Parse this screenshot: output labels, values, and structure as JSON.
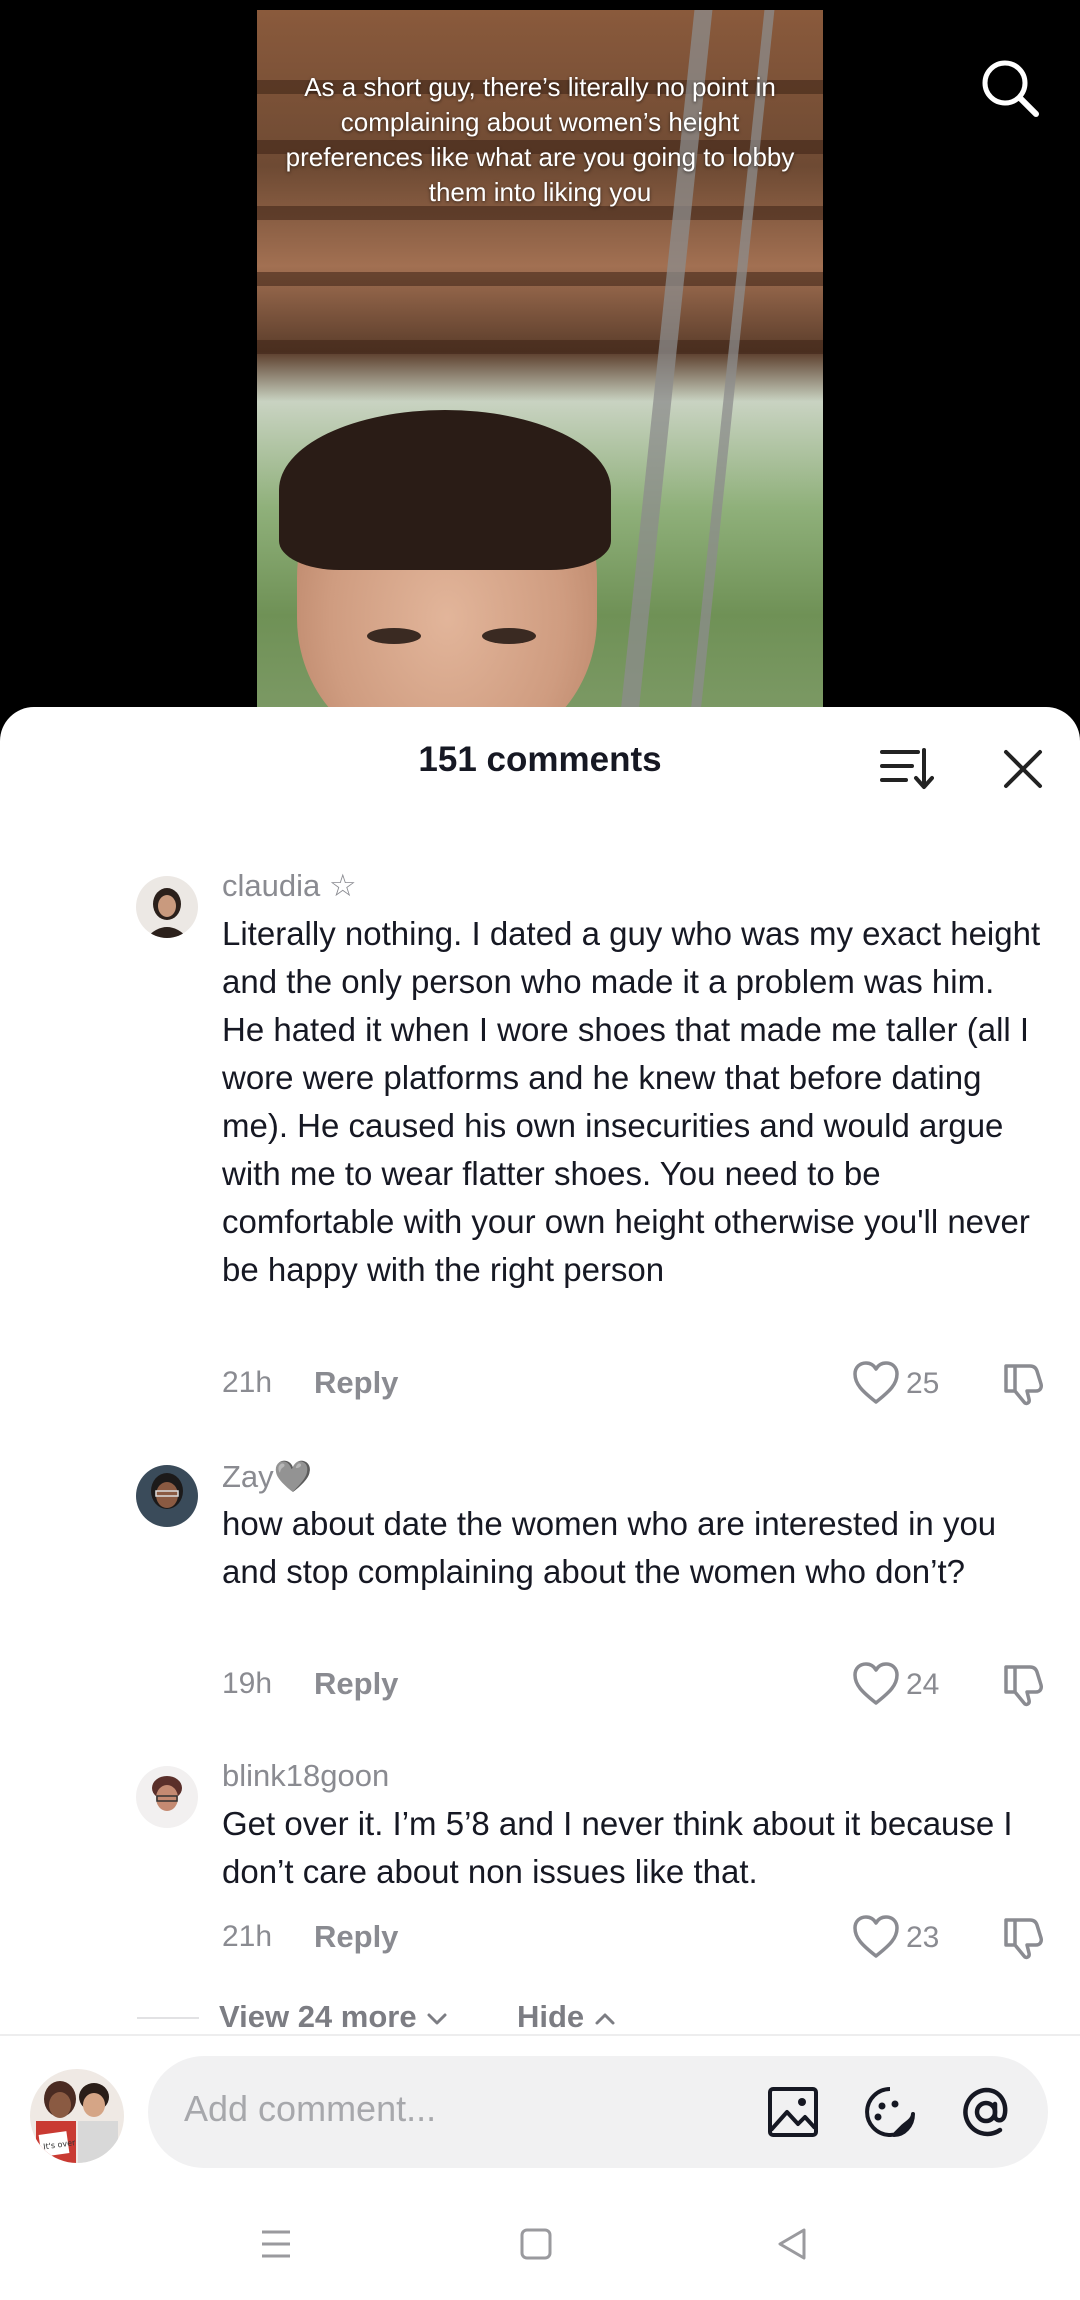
{
  "video": {
    "caption": "As a short guy, there’s literally no point in complaining about women’s height preferences like what are you going to lobby them into liking you"
  },
  "comments_sheet": {
    "title": "151 comments"
  },
  "comments": [
    {
      "username": "claudia ☆",
      "text": "Literally nothing. I dated a guy who was my exact height and the only person who made it a problem was him. He hated it when I wore shoes that made me taller (all I wore were platforms and he knew that before dating me). He caused his own insecurities and would argue with me to wear flatter shoes. You need to be comfortable with your own height otherwise you'll never be happy with the right person",
      "time": "21h",
      "reply_label": "Reply",
      "likes": "25"
    },
    {
      "username": "Zay🩶",
      "text": "how about date the women who are interested in you and stop complaining about the women who don’t?",
      "time": "19h",
      "reply_label": "Reply",
      "likes": "24"
    },
    {
      "username": "blink18goon",
      "text": "Get over it. I’m 5’8 and I never think about it because I don’t care about non issues like that.",
      "time": "21h",
      "reply_label": "Reply",
      "likes": "23"
    }
  ],
  "replies_controls": {
    "view_more_label": "View 24 more",
    "hide_label": "Hide"
  },
  "composer": {
    "placeholder": "Add comment...",
    "avatar_text": "It's over"
  },
  "icons": {
    "search": "search-icon",
    "sort": "sort-icon",
    "close": "close-icon",
    "like": "heart-outline-icon",
    "dislike": "thumbs-down-icon",
    "image": "image-icon",
    "sticker": "sticker-icon",
    "mention": "at-mention-icon",
    "nav_recents": "recents-icon",
    "nav_home": "home-icon",
    "nav_back": "back-icon"
  },
  "colors": {
    "text_primary": "#161823",
    "text_secondary": "#8a8b91",
    "sheet_bg": "#ffffff",
    "input_bg": "#f1f1f2"
  }
}
